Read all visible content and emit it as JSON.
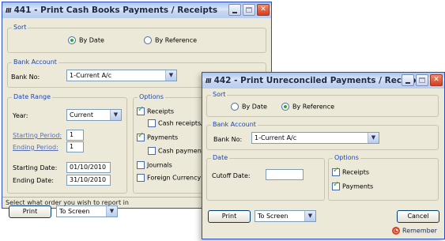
{
  "window1": {
    "icon_label": "Ⅲ",
    "title": "441 - Print Cash Books Payments / Receipts",
    "sort": {
      "legend": "Sort",
      "by_date": "By Date",
      "by_reference": "By Reference",
      "selected": "by_date"
    },
    "bank_account": {
      "legend": "Bank Account",
      "label": "Bank No:",
      "value": "1-Current A/c"
    },
    "date_range": {
      "legend": "Date Range",
      "year_label": "Year:",
      "year_value": "Current",
      "starting_period_label": "Starting Period:",
      "starting_period_value": "1",
      "ending_period_label": "Ending Period:",
      "ending_period_value": "1",
      "starting_date_label": "Starting Date:",
      "starting_date_value": "01/10/2010",
      "ending_date_label": "Ending Date:",
      "ending_date_value": "31/10/2010"
    },
    "options": {
      "legend": "Options",
      "receipts": "Receipts",
      "cash_receipts": "Cash receipts/s",
      "payments": "Payments",
      "cash_payments": "Cash payments",
      "journals": "Journals",
      "foreign_currency": "Foreign Currency",
      "checked": {
        "receipts": true,
        "cash_receipts": false,
        "payments": true,
        "cash_payments": false,
        "journals": false,
        "foreign_currency": false
      }
    },
    "print_label": "Print",
    "output_value": "To Screen",
    "status": "Select what order you wish to report in"
  },
  "window2": {
    "icon_label": "Ⅲ",
    "title": "442 - Print Unreconciled Payments / Receipts",
    "sort": {
      "legend": "Sort",
      "by_date": "By Date",
      "by_reference": "By Reference",
      "selected": "by_reference"
    },
    "bank_account": {
      "legend": "Bank Account",
      "label": "Bank No:",
      "value": "1-Current A/c"
    },
    "date": {
      "legend": "Date",
      "cutoff_label": "Cutoff Date:",
      "cutoff_value": ""
    },
    "options": {
      "legend": "Options",
      "receipts": "Receipts",
      "payments": "Payments",
      "checked": {
        "receipts": true,
        "payments": true
      }
    },
    "print_label": "Print",
    "output_value": "To Screen",
    "cancel_label": "Cancel",
    "remember_label": "Remember"
  },
  "colors": {
    "title_gradient_top": "#a9c4ee",
    "close_button": "#d0401e",
    "group_legend": "#1c47b8",
    "check_green": "#2ea82e"
  }
}
